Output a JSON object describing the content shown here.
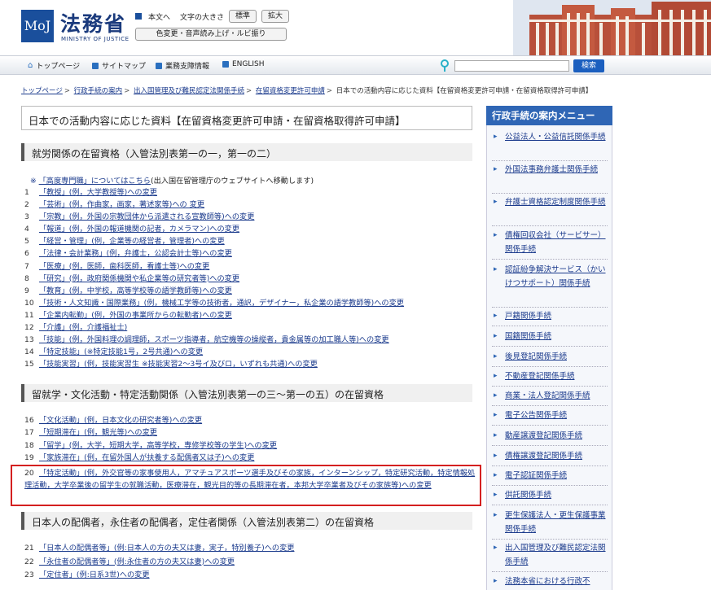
{
  "header": {
    "logo_mark": "MoJ",
    "logo_title": "法務省",
    "logo_sub": "MINISTRY OF JUSTICE",
    "skip_link": "本文へ",
    "font_size_label": "文字の大きさ",
    "font_standard": "標準",
    "font_large": "拡大",
    "color_tools": "色変更・音声読み上げ・ルビ振り"
  },
  "nav": {
    "items": [
      "トップページ",
      "サイトマップ",
      "業務支障情報",
      "ENGLISH"
    ],
    "search_button": "検索",
    "search_value": ""
  },
  "breadcrumb": [
    "トップページ",
    "行政手続の案内",
    "出入国管理及び難民認定法関係手続",
    "在留資格変更許可申請",
    "日本での活動内容に応じた資料【在留資格変更許可申請・在留資格取得許可申請】"
  ],
  "page_title": "日本での活動内容に応じた資料【在留資格変更許可申請・在留資格取得許可申請】",
  "section1": {
    "heading": "就労関係の在留資格（入管法別表第一の一，第一の二）",
    "note_mark": "※",
    "note_link": "「高度専門職」についてはこちら",
    "note_suffix": "(出入国在留管理庁のウェブサイトへ移動します)",
    "items": [
      {
        "n": "1",
        "t": "「教授」(例，大学教授等)への変更"
      },
      {
        "n": "2",
        "t": "「芸術」(例，作曲家，画家，著述家等)への 変更"
      },
      {
        "n": "3",
        "t": "「宗教」(例，外国の宗教団体から派遣される宣教師等)への変更"
      },
      {
        "n": "4",
        "t": "「報道」(例，外国の報道機関の記者，カメラマン)への変更"
      },
      {
        "n": "5",
        "t": "「経営・管理」(例，企業等の経営者，管理者)への変更"
      },
      {
        "n": "6",
        "t": "「法律・会計業務」(例，弁護士，公認会計士等)への変更"
      },
      {
        "n": "7",
        "t": "「医療」(例，医師，歯科医師，看護士等)への変更"
      },
      {
        "n": "8",
        "t": "「研究」(例，政府関係機関や私企業等の研究者等)への変更"
      },
      {
        "n": "9",
        "t": "「教育」(例，中学校，高等学校等の語学教師等)への変更"
      },
      {
        "n": "10",
        "t": "「技術・人文知識・国際業務」(例，機械工学等の技術者，通訳，デザイナー，私企業の語学教師等)への変更"
      },
      {
        "n": "11",
        "t": "「企業内転勤」(例，外国の事業所からの転勤者)への変更"
      },
      {
        "n": "12",
        "t": "「介護」(例，介護福祉士)"
      },
      {
        "n": "13",
        "t": "「技能」(例，外国料理の調理師，スポーツ指導者，航空機等の操縦者，貴金属等の加工職人等)への変更"
      },
      {
        "n": "14",
        "t": "「特定技能」(※特定技能1号，2号共通)への変更"
      },
      {
        "n": "15",
        "t": "「技能実習」(例，技能実習生 ※技能実習2～3号イ及びロ，いずれも共通)への変更"
      }
    ]
  },
  "section2": {
    "heading": "留就学・文化活動・特定活動関係（入管法別表第一の三～第一の五）の在留資格",
    "items": [
      {
        "n": "16",
        "t": "「文化活動」(例，日本文化の研究者等)への変更"
      },
      {
        "n": "17",
        "t": "「短期滞在」(例，観光等)への変更"
      },
      {
        "n": "18",
        "t": "「留学」(例，大学，短期大学，高等学校，専修学校等の学生)への変更"
      },
      {
        "n": "19",
        "t": "「家族滞在」(例，在留外国人が扶養する配偶者又は子)への変更"
      }
    ],
    "item20_num": "20",
    "item20_text": "「特定活動」(例，外交官等の家事使用人，アマチュアスポーツ選手及びその家族，インターンシップ，特定研究活動，特定情報処理活動，大学卒業後の留学生の就職活動，医療滞在，観光目的等の長期滞在者，本邦大学卒業者及びその家族等)への変更"
  },
  "section3": {
    "heading": "日本人の配偶者，永住者の配偶者，定住者関係（入管法別表第二）の在留資格",
    "items": [
      {
        "n": "21",
        "t": "「日本人の配偶者等」(例:日本人の方の夫又は妻，実子，特別養子)への変更"
      },
      {
        "n": "22",
        "t": "「永住者の配偶者等」(例:永住者の方の夫又は妻)への変更"
      },
      {
        "n": "23",
        "t": "「定住者」(例:日系3世)への変更"
      }
    ]
  },
  "sidebar": {
    "heading": "行政手続の案内メニュー",
    "items": [
      "公益法人・公益信託関係手続",
      "外国法事務弁護士関係手続",
      "弁護士資格認定制度関係手続",
      "債権回収会社（サービサー）関係手続",
      "認証紛争解決サービス（かいけつサポート）関係手続",
      "戸籍関係手続",
      "国籍関係手続",
      "後見登記関係手続",
      "不動産登記関係手続",
      "商業・法人登記関係手続",
      "電子公告関係手続",
      "動産譲渡登記関係手続",
      "債権譲渡登記関係手続",
      "電子認証関係手続",
      "供託関係手続",
      "更生保護法人・更生保護事業関係手続",
      "出入国管理及び難民認定法関係手続",
      "法務本省における行政不"
    ]
  },
  "colors": {
    "accent": "#2f66b5",
    "highlight": "#d42020",
    "link": "#1a3a8c"
  }
}
